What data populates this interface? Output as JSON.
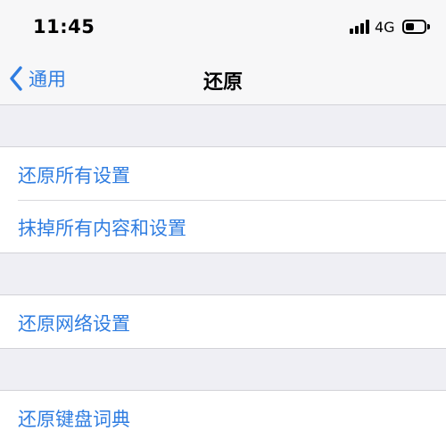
{
  "status_bar": {
    "time": "11:45",
    "network": "4G",
    "signal_icon": "cellular-signal-icon",
    "battery_icon": "battery-icon"
  },
  "nav": {
    "back_icon": "chevron-left-icon",
    "back_label": "通用",
    "title": "还原"
  },
  "groups": [
    {
      "items": [
        {
          "label": "还原所有设置"
        },
        {
          "label": "抹掉所有内容和设置"
        }
      ]
    },
    {
      "items": [
        {
          "label": "还原网络设置"
        }
      ]
    },
    {
      "items": [
        {
          "label": "还原键盘词典"
        }
      ]
    }
  ],
  "colors": {
    "accent": "#2f7de1",
    "background": "#efeff4"
  }
}
